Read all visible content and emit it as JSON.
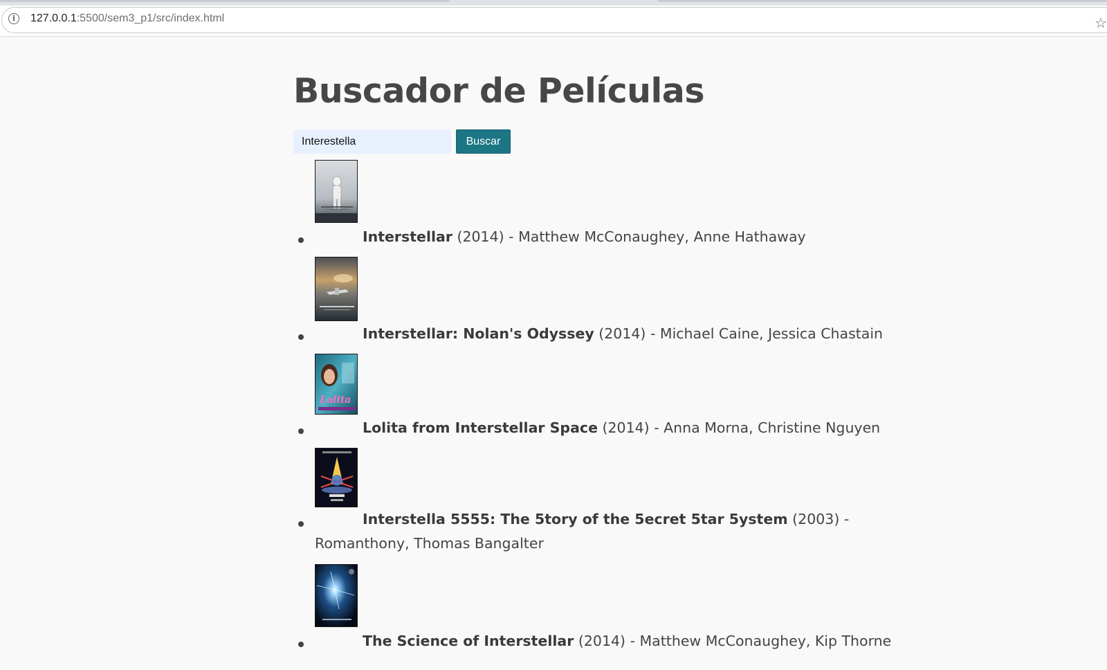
{
  "browser": {
    "url_host": "127.0.0.1",
    "url_path": ":5500/sem3_p1/src/index.html",
    "info_icon": "info-icon",
    "bookmark_icon": "star-icon"
  },
  "page": {
    "title": "Buscador de Películas",
    "search": {
      "value": "Interestella",
      "button_label": "Buscar"
    },
    "results": [
      {
        "title": "Interstellar",
        "year": "(2014)",
        "separator": "-",
        "cast": "Matthew McConaughey, Anne Hathaway",
        "poster": "astronaut-poster"
      },
      {
        "title": "Interstellar: Nolan's Odyssey",
        "year": "(2014)",
        "separator": "-",
        "cast": "Michael Caine, Jessica Chastain",
        "poster": "spacecraft-poster"
      },
      {
        "title": "Lolita from Interstellar Space",
        "year": "(2014)",
        "separator": "-",
        "cast": "Anna Morna, Christine Nguyen",
        "poster": "lolita-poster"
      },
      {
        "title": "Interstella 5555: The 5tory of the 5ecret 5tar 5ystem",
        "year": "(2003)",
        "separator": "-",
        "cast": "Romanthony, Thomas Bangalter",
        "poster": "interstella-5555-poster"
      },
      {
        "title": "The Science of Interstellar",
        "year": "(2014)",
        "separator": "-",
        "cast": "Matthew McConaughey, Kip Thorne",
        "poster": "science-poster"
      }
    ]
  }
}
